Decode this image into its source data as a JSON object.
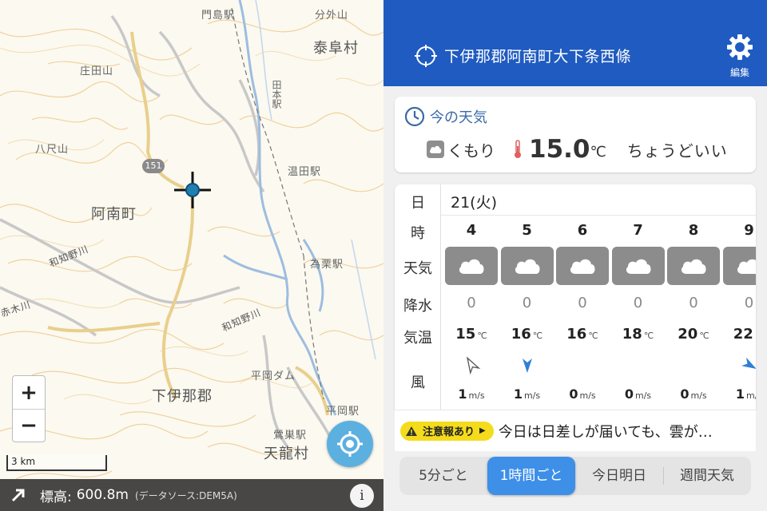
{
  "map": {
    "labels": {
      "kadoshima_station": "門島駅",
      "bungayama": "分外山",
      "yasuoka_village": "泰阜村",
      "shodayama": "庄田山",
      "tamoto_station": "田本駅",
      "yashakuyama": "八尺山",
      "route_number": "151",
      "nukuta_station": "温田駅",
      "anan_town": "阿南町",
      "wagino_river_1": "和知野川",
      "tamesu_station": "為栗駅",
      "unnamed_river": "赤木川",
      "wagino_river_2": "和知野川",
      "hiraoka_dam": "平岡ダム",
      "shimoina_district": "下伊那郡",
      "hiraoka_station": "平岡駅",
      "ushirojima_station": "鶯巣駅",
      "tenryu_village": "天龍村"
    },
    "zoom_in_label": "+",
    "zoom_out_label": "−",
    "scale_label": "3 km",
    "elevation": {
      "label": "標高:",
      "value": "600.8m",
      "source": "(データソース:DEM5A)"
    },
    "info_label": "i"
  },
  "header": {
    "location": "下伊那郡阿南町大下条西條",
    "edit_label": "編集"
  },
  "now": {
    "title": "今の天気",
    "condition": "くもり",
    "temperature": "15.0",
    "temperature_unit": "℃",
    "feel": "ちょうどいい"
  },
  "forecast": {
    "row_labels": {
      "day": "日",
      "hour": "時",
      "weather": "天気",
      "precip": "降水",
      "temp": "気温",
      "wind": "風"
    },
    "date": "21(火)",
    "temp_unit": "℃",
    "wind_unit": "m/s",
    "hours": [
      {
        "hour": "4",
        "precip": "0",
        "temp": "15",
        "wind": "1",
        "wind_dir_deg": 330,
        "wind_style": "outline"
      },
      {
        "hour": "5",
        "precip": "0",
        "temp": "16",
        "wind": "1",
        "wind_dir_deg": 180,
        "wind_style": "filled"
      },
      {
        "hour": "6",
        "precip": "0",
        "temp": "16",
        "wind": "0",
        "wind_dir_deg": null,
        "wind_style": "none"
      },
      {
        "hour": "7",
        "precip": "0",
        "temp": "18",
        "wind": "0",
        "wind_dir_deg": null,
        "wind_style": "none"
      },
      {
        "hour": "8",
        "precip": "0",
        "temp": "20",
        "wind": "0",
        "wind_dir_deg": null,
        "wind_style": "none"
      },
      {
        "hour": "9",
        "precip": "0",
        "temp": "22",
        "wind": "1",
        "wind_dir_deg": 120,
        "wind_style": "filled"
      }
    ]
  },
  "alert": {
    "badge": "注意報あり",
    "text": "今日は日差しが届いても、雲が…"
  },
  "tabs": [
    {
      "label": "5分ごと",
      "active": false
    },
    {
      "label": "1時間ごと",
      "active": true
    },
    {
      "label": "今日明日",
      "active": false
    },
    {
      "label": "週間天気",
      "active": false
    }
  ],
  "colors": {
    "header": "#1f5bc0",
    "accent": "#3d8fe8",
    "alert": "#f4dc1c",
    "wind_arrow": "#2f7fd6"
  }
}
